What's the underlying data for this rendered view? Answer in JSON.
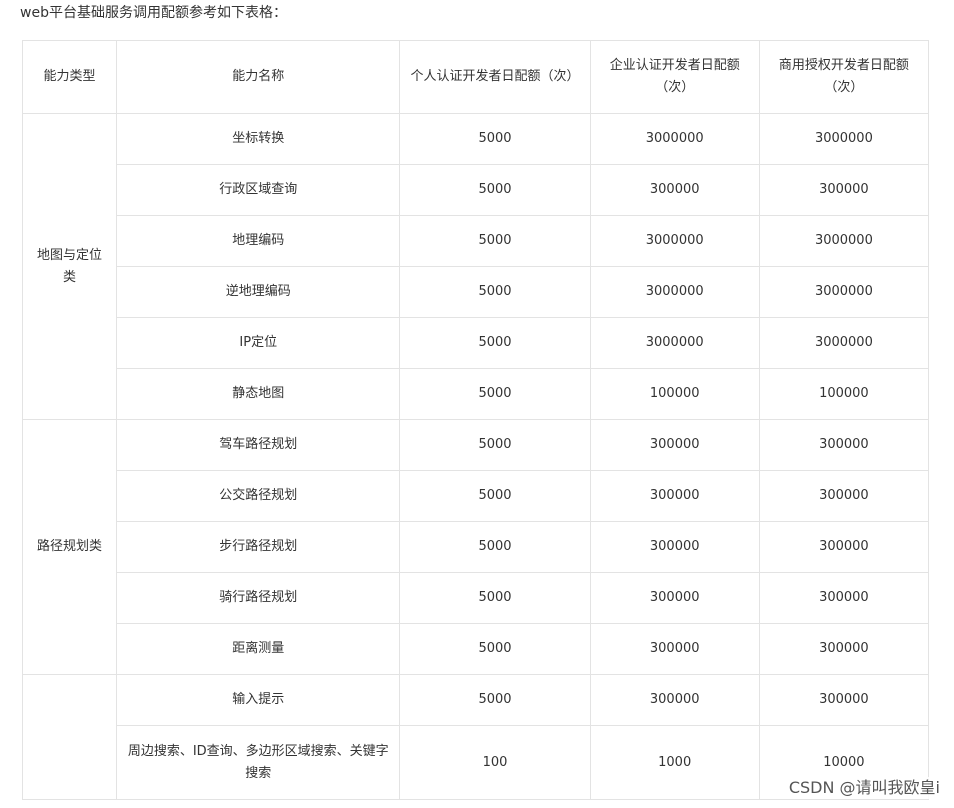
{
  "intro": "web平台基础服务调用配额参考如下表格：",
  "table": {
    "headers": {
      "type": "能力类型",
      "name": "能力名称",
      "individual": "个人认证开发者日配额（次）",
      "enterprise": "企业认证开发者日配额（次）",
      "commercial": "商用授权开发者日配额（次）"
    },
    "groups": [
      {
        "type": "地图与定位类",
        "rows": [
          {
            "name": "坐标转换",
            "individual": "5000",
            "enterprise": "3000000",
            "commercial": "3000000"
          },
          {
            "name": "行政区域查询",
            "individual": "5000",
            "enterprise": "300000",
            "commercial": "300000"
          },
          {
            "name": "地理编码",
            "individual": "5000",
            "enterprise": "3000000",
            "commercial": "3000000"
          },
          {
            "name": "逆地理编码",
            "individual": "5000",
            "enterprise": "3000000",
            "commercial": "3000000"
          },
          {
            "name": "IP定位",
            "individual": "5000",
            "enterprise": "3000000",
            "commercial": "3000000"
          },
          {
            "name": "静态地图",
            "individual": "5000",
            "enterprise": "100000",
            "commercial": "100000"
          }
        ]
      },
      {
        "type": "路径规划类",
        "rows": [
          {
            "name": "驾车路径规划",
            "individual": "5000",
            "enterprise": "300000",
            "commercial": "300000"
          },
          {
            "name": "公交路径规划",
            "individual": "5000",
            "enterprise": "300000",
            "commercial": "300000"
          },
          {
            "name": "步行路径规划",
            "individual": "5000",
            "enterprise": "300000",
            "commercial": "300000"
          },
          {
            "name": "骑行路径规划",
            "individual": "5000",
            "enterprise": "300000",
            "commercial": "300000"
          },
          {
            "name": "距离测量",
            "individual": "5000",
            "enterprise": "300000",
            "commercial": "300000"
          }
        ]
      },
      {
        "type": "",
        "rows": [
          {
            "name": "输入提示",
            "individual": "5000",
            "enterprise": "300000",
            "commercial": "300000"
          },
          {
            "name": "周边搜索、ID查询、多边形区域搜索、关键字搜索",
            "individual": "100",
            "enterprise": "1000",
            "commercial": "10000"
          }
        ]
      }
    ]
  },
  "watermark": "CSDN @请叫我欧皇i"
}
